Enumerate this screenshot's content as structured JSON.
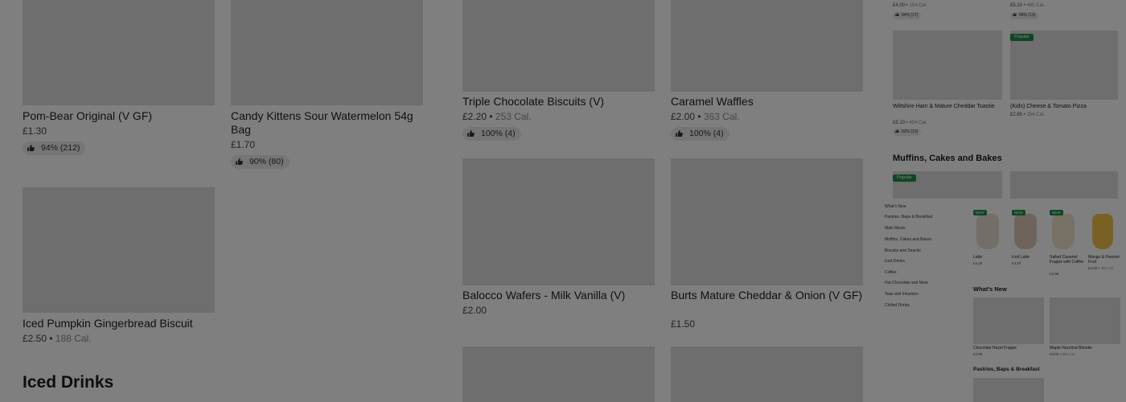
{
  "panel1": {
    "items": [
      {
        "name": "Pom-Bear Original (V GF)",
        "price": "£1.30",
        "calories": "",
        "rating": "94% (212)"
      },
      {
        "name": "Candy Kittens Sour Watermelon 54g Bag",
        "price": "£1.70",
        "calories": "",
        "rating": "90% (80)"
      },
      {
        "name": "Iced Pumpkin Gingerbread Biscuit",
        "price": "£2.50",
        "calories": "188 Cal.",
        "rating": ""
      }
    ],
    "section_heading": "Iced Drinks"
  },
  "panel2": {
    "items": [
      {
        "name": "Triple Chocolate Biscuits (V)",
        "price": "£2.20",
        "calories": "253 Cal.",
        "rating": "100% (4)"
      },
      {
        "name": "Caramel Waffles",
        "price": "£2.00",
        "calories": "363 Cal.",
        "rating": "100% (4)"
      },
      {
        "name": "Balocco Wafers - Milk Vanilla (V)",
        "price": "£2.00",
        "calories": "",
        "rating": ""
      },
      {
        "name": "Burts Mature Cheddar & Onion (V GF)",
        "price": "£1.50",
        "calories": "",
        "rating": ""
      }
    ]
  },
  "panel3": {
    "top_items": [
      {
        "price": "£4.00",
        "calories": "154 Cal.",
        "rating": "94% (17)"
      },
      {
        "price": "£5.10",
        "calories": "480 Cal.",
        "rating": "89% (13)"
      }
    ],
    "items": [
      {
        "name": "Wiltshire Ham & Mature Cheddar Toastie",
        "price": "£5.10",
        "calories": "454 Cal.",
        "rating": "92% (13)",
        "badge": ""
      },
      {
        "name": "(Kids) Cheese & Tomato Pizza",
        "price": "£2.85",
        "calories": "154 Cal.",
        "rating": "",
        "badge": "Popular"
      }
    ],
    "section_heading": "Muffins, Cakes and Bakes",
    "section_badge": "Popular"
  },
  "panel4": {
    "nav": [
      "What's New",
      "Pastries, Baps & Breakfast",
      "Main Meals",
      "Muffins, Cakes and Bakes",
      "Biscuits and Snacks",
      "Iced Drinks",
      "Coffee",
      "Hot Chocolate and More",
      "Teas and Infusions",
      "Chilled Drinks"
    ],
    "drinks": [
      {
        "name": "Latte",
        "price": "£4.20",
        "calories": "",
        "badge": "NEW"
      },
      {
        "name": "Iced Latte",
        "price": "£4.20",
        "calories": "",
        "badge": "NEW"
      },
      {
        "name": "Salted Caramel Frappe with Coffee",
        "price": "£4.95",
        "calories": "",
        "badge": "NEW"
      },
      {
        "name": "Mango & Passion Fruit",
        "price": "£4.00",
        "calories": "360 Cal.",
        "badge": ""
      }
    ],
    "whats_new_heading": "What's New",
    "new_items": [
      {
        "name": "Chocolate Hazel Frappe",
        "price": "£4.95",
        "calories": ""
      },
      {
        "name": "Maple Hazelnut Blondie",
        "price": "£3.00",
        "calories": "306 Cal."
      }
    ],
    "pastries_heading": "Pastries, Baps & Breakfast"
  },
  "colors": {
    "badge_green": "#1f8c4a",
    "overlay": "rgba(0,0,0,0.5)"
  }
}
